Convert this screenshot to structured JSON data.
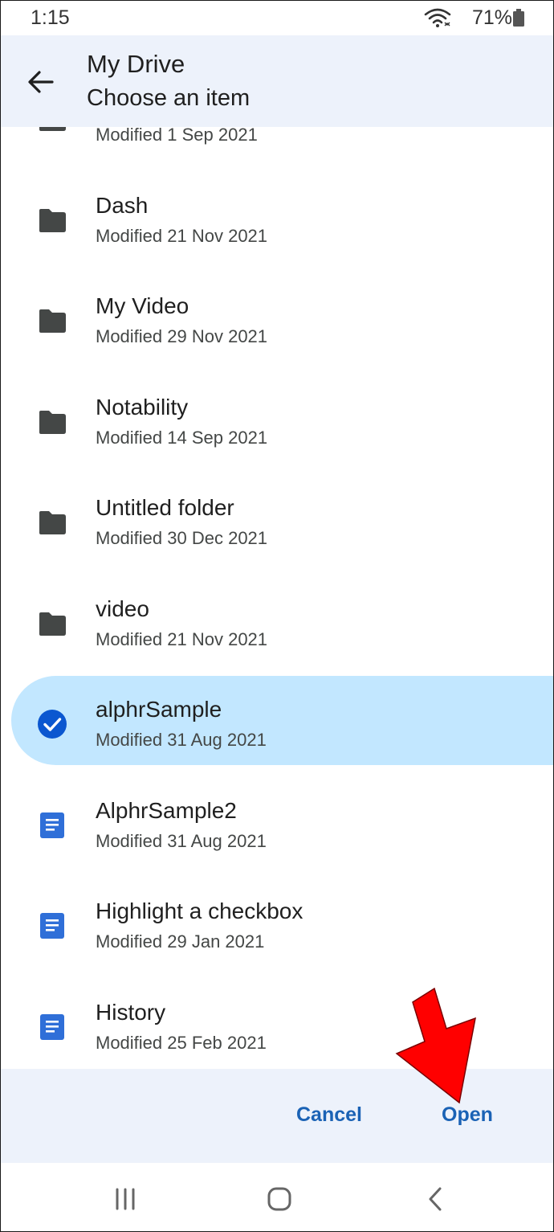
{
  "status_bar": {
    "time": "1:15",
    "battery": "71%"
  },
  "header": {
    "title": "My Drive",
    "subtitle": "Choose an item"
  },
  "items": [
    {
      "name": "",
      "modified": "Modified 1 Sep 2021",
      "type": "folder",
      "selected": false
    },
    {
      "name": "Dash",
      "modified": "Modified 21 Nov 2021",
      "type": "folder",
      "selected": false
    },
    {
      "name": "My Video",
      "modified": "Modified 29 Nov 2021",
      "type": "folder",
      "selected": false
    },
    {
      "name": "Notability",
      "modified": "Modified 14 Sep 2021",
      "type": "folder",
      "selected": false
    },
    {
      "name": "Untitled folder",
      "modified": "Modified 30 Dec 2021",
      "type": "folder",
      "selected": false
    },
    {
      "name": "video",
      "modified": "Modified 21 Nov 2021",
      "type": "folder",
      "selected": false
    },
    {
      "name": "alphrSample",
      "modified": "Modified 31 Aug 2021",
      "type": "check-circle",
      "selected": true
    },
    {
      "name": "AlphrSample2",
      "modified": "Modified 31 Aug 2021",
      "type": "doc",
      "selected": false
    },
    {
      "name": "Highlight a checkbox",
      "modified": "Modified 29 Jan 2021",
      "type": "doc",
      "selected": false
    },
    {
      "name": "History",
      "modified": "Modified 25 Feb 2021",
      "type": "doc",
      "selected": false
    }
  ],
  "footer": {
    "cancel_label": "Cancel",
    "open_label": "Open"
  },
  "colors": {
    "header_bg": "#edf2fb",
    "selected_bg": "#c2e7ff",
    "accent_blue": "#1a62b5",
    "doc_blue": "#2f6fd8",
    "folder_gray": "#444746",
    "annotation_red": "#ff0000"
  },
  "icons": {
    "back": "arrow-left-icon",
    "wifi": "wifi-icon",
    "battery": "battery-icon",
    "folder": "folder-icon",
    "doc": "google-doc-icon",
    "selected": "check-circle-icon",
    "nav_recents": "recents-icon",
    "nav_home": "home-icon",
    "nav_back": "chevron-left-icon"
  }
}
